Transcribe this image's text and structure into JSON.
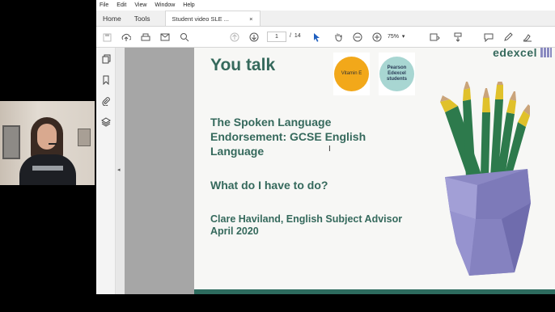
{
  "menu": [
    "File",
    "Edit",
    "View",
    "Window",
    "Help"
  ],
  "tabs": {
    "home": "Home",
    "tools": "Tools",
    "document": "Student video SLE ...",
    "close": "×"
  },
  "toolbar": {
    "current_page": "1",
    "page_separator": "/",
    "total_pages": "14",
    "zoom": "75%"
  },
  "slide": {
    "title": "You talk",
    "badge_left": "Vitamin E",
    "badge_right": "Pearson Edexcel students",
    "brand": "edexcel",
    "heading1_line1": "The Spoken Language",
    "heading1_line2": "Endorsement: GCSE English",
    "heading1_line3": "Language",
    "heading2": "What do I have to do?",
    "author": "Clare Haviland, English Subject Advisor",
    "date": "April 2020"
  },
  "colors": {
    "accent_text": "#35695c",
    "badge_left_bg": "#f2a81a",
    "badge_right_bg": "#a8d6d2",
    "pot": "#8b88c4",
    "pencil_green": "#2d7a4c",
    "pencil_yellow": "#e0c12b"
  }
}
